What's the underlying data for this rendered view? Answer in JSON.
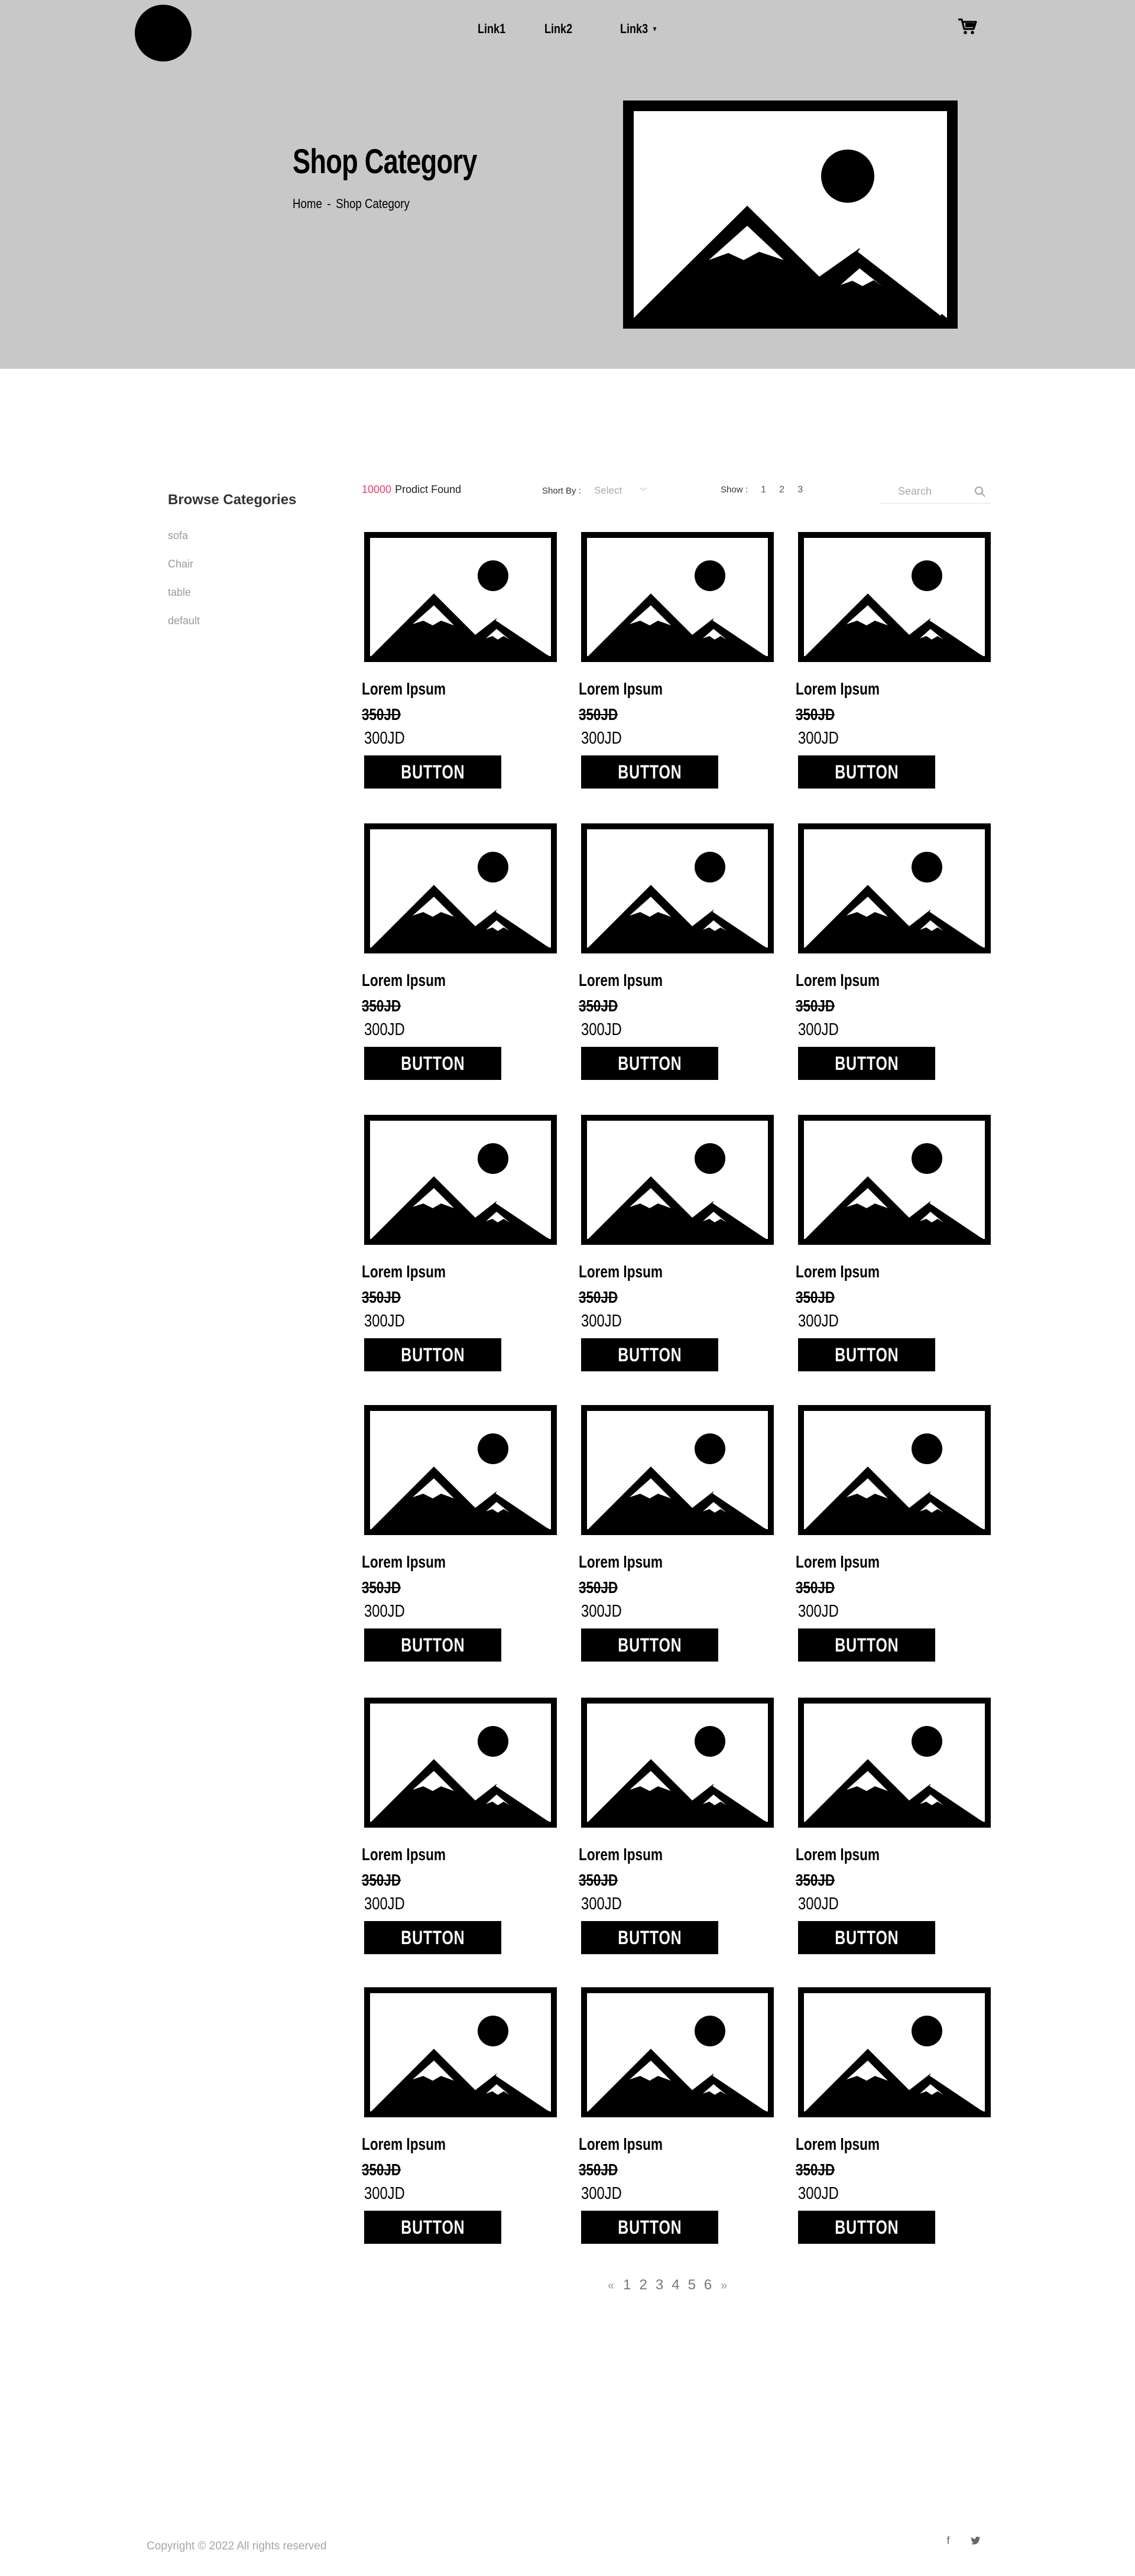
{
  "header": {
    "nav": [
      {
        "label": "Link1"
      },
      {
        "label": "Link2"
      },
      {
        "label": "Link3"
      }
    ]
  },
  "hero": {
    "title": "Shop Category",
    "breadcrumb": [
      "Home",
      "Shop Category"
    ],
    "breadcrumb_separator": "-"
  },
  "sidebar": {
    "title": "Browse Categories",
    "items": [
      "sofa",
      "Chair",
      "table",
      "default"
    ]
  },
  "toolbar": {
    "count": "10000",
    "found_label": "Prodict Found",
    "sort_label": "Short By :",
    "sort_value": "Select",
    "show_label": "Show :",
    "show_options": [
      "1",
      "2",
      "3"
    ],
    "search_placeholder": "Search"
  },
  "products": [
    {
      "title": "Lorem Ipsum",
      "old_price": "350JD",
      "price": "300JD",
      "button": "BUTTON"
    },
    {
      "title": "Lorem Ipsum",
      "old_price": "350JD",
      "price": "300JD",
      "button": "BUTTON"
    },
    {
      "title": "Lorem Ipsum",
      "old_price": "350JD",
      "price": "300JD",
      "button": "BUTTON"
    },
    {
      "title": "Lorem Ipsum",
      "old_price": "350JD",
      "price": "300JD",
      "button": "BUTTON"
    },
    {
      "title": "Lorem Ipsum",
      "old_price": "350JD",
      "price": "300JD",
      "button": "BUTTON"
    },
    {
      "title": "Lorem Ipsum",
      "old_price": "350JD",
      "price": "300JD",
      "button": "BUTTON"
    },
    {
      "title": "Lorem Ipsum",
      "old_price": "350JD",
      "price": "300JD",
      "button": "BUTTON"
    },
    {
      "title": "Lorem Ipsum",
      "old_price": "350JD",
      "price": "300JD",
      "button": "BUTTON"
    },
    {
      "title": "Lorem Ipsum",
      "old_price": "350JD",
      "price": "300JD",
      "button": "BUTTON"
    },
    {
      "title": "Lorem Ipsum",
      "old_price": "350JD",
      "price": "300JD",
      "button": "BUTTON"
    },
    {
      "title": "Lorem Ipsum",
      "old_price": "350JD",
      "price": "300JD",
      "button": "BUTTON"
    },
    {
      "title": "Lorem Ipsum",
      "old_price": "350JD",
      "price": "300JD",
      "button": "BUTTON"
    },
    {
      "title": "Lorem Ipsum",
      "old_price": "350JD",
      "price": "300JD",
      "button": "BUTTON"
    },
    {
      "title": "Lorem Ipsum",
      "old_price": "350JD",
      "price": "300JD",
      "button": "BUTTON"
    },
    {
      "title": "Lorem Ipsum",
      "old_price": "350JD",
      "price": "300JD",
      "button": "BUTTON"
    },
    {
      "title": "Lorem Ipsum",
      "old_price": "350JD",
      "price": "300JD",
      "button": "BUTTON"
    },
    {
      "title": "Lorem Ipsum",
      "old_price": "350JD",
      "price": "300JD",
      "button": "BUTTON"
    },
    {
      "title": "Lorem Ipsum",
      "old_price": "350JD",
      "price": "300JD",
      "button": "BUTTON"
    }
  ],
  "pagination": {
    "prev": "«",
    "pages": [
      "1",
      "2",
      "3",
      "4",
      "5",
      "6"
    ],
    "next": "»"
  },
  "footer": {
    "copyright": "Copyright © 2022 All rights reserved",
    "social": [
      {
        "icon": "facebook-icon",
        "glyph": "f"
      },
      {
        "icon": "twitter-icon",
        "glyph": ""
      }
    ]
  },
  "colors": {
    "hero_bg": "#c8c8c8",
    "accent": "#e83e6b",
    "button_bg": "#000000"
  }
}
